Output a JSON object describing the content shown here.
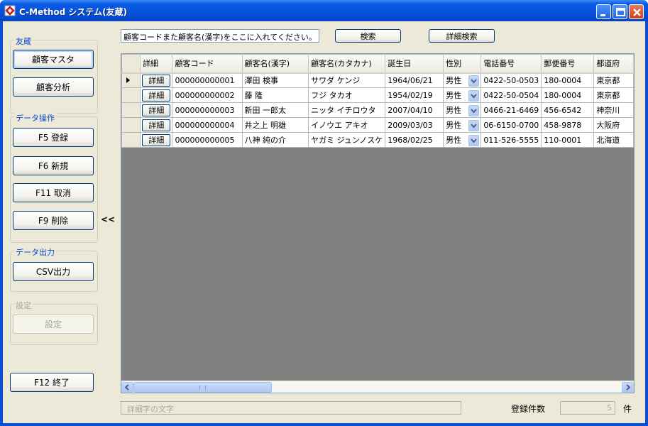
{
  "window": {
    "title": "C-Method システム(友蔵)"
  },
  "sidebar": {
    "group1_label": "友蔵",
    "customer_master": "顧客マスタ",
    "customer_analysis": "顧客分析",
    "group2_label": "データ操作",
    "register": "F5 登録",
    "new": "F6 新規",
    "cancel": "F11 取消",
    "delete": "F9 削除",
    "group3_label": "データ出力",
    "csv": "CSV出力",
    "group4_label": "設定",
    "settings": "設定",
    "exit": "F12 終了",
    "collapse": "<<"
  },
  "search": {
    "value": "顧客コードまた顧客名(漢字)をここに入れてください。",
    "search_button": "検索",
    "detail_search_button": "詳細検索"
  },
  "grid": {
    "headers": [
      "詳細",
      "顧客コード",
      "顧客名(漢字)",
      "顧客名(カタカナ)",
      "誕生日",
      "性別",
      "電話番号",
      "郵便番号",
      "都道府"
    ],
    "detail_button": "詳細",
    "rows": [
      {
        "code": "000000000001",
        "name": "澤田 検事",
        "kana": "サワダ ケンジ",
        "birth": "1964/06/21",
        "sex": "男性",
        "tel": "0422-50-0503",
        "zip": "180-0004",
        "pref": "東京都"
      },
      {
        "code": "000000000002",
        "name": "藤 隆",
        "kana": "フジ タカオ",
        "birth": "1954/02/19",
        "sex": "男性",
        "tel": "0422-50-0504",
        "zip": "180-0004",
        "pref": "東京都"
      },
      {
        "code": "000000000003",
        "name": "新田 一郎太",
        "kana": "ニッタ イチロウタ",
        "birth": "2007/04/10",
        "sex": "男性",
        "tel": "0466-21-6469",
        "zip": "456-6542",
        "pref": "神奈川"
      },
      {
        "code": "000000000004",
        "name": "井之上 明雄",
        "kana": "イノウエ アキオ",
        "birth": "2009/03/03",
        "sex": "男性",
        "tel": "06-6150-0700",
        "zip": "458-9878",
        "pref": "大阪府"
      },
      {
        "code": "000000000005",
        "name": "八神 純の介",
        "kana": "ヤガミ ジュンノスケ",
        "birth": "1968/02/25",
        "sex": "男性",
        "tel": "011-526-5555",
        "zip": "110-0001",
        "pref": "北海道"
      }
    ]
  },
  "footer": {
    "status_text": "詳細字の文字",
    "count_label": "登録件数",
    "count_value": "5",
    "count_unit": "件"
  }
}
